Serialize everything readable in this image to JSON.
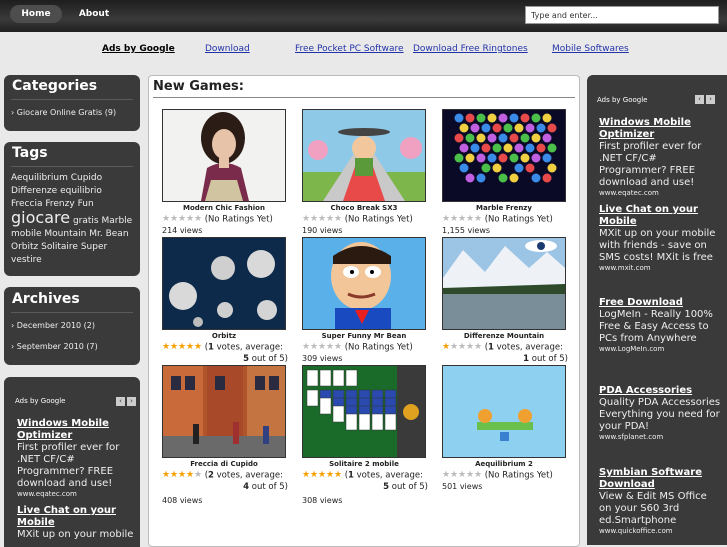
{
  "nav": {
    "home": "Home",
    "about": "About"
  },
  "search": {
    "placeholder": "Type and enter..."
  },
  "linkbar": {
    "ads_by_google": "Ads by Google",
    "links": [
      "Download",
      "Free Pocket PC Software",
      "Download Free Ringtones",
      "Mobile Softwares"
    ]
  },
  "categories": {
    "title": "Categories",
    "items": [
      "Giocare Online Gratis (9)"
    ]
  },
  "tags": {
    "title": "Tags",
    "words": [
      "Aequilibrium",
      "Cupido",
      "Differenze",
      "equilibrio",
      "Freccia",
      "Frenzy",
      "Fun",
      "giocare",
      "gratis",
      "Marble",
      "mobile",
      "Mountain",
      "Mr.",
      "Bean",
      "Orbitz",
      "Solitaire",
      "Super",
      "vestire"
    ]
  },
  "archives": {
    "title": "Archives",
    "items": [
      "December 2010 (2)",
      "September 2010 (7)"
    ]
  },
  "left_ads": {
    "header": "Ads by Google",
    "ads": [
      {
        "title": "Windows Mobile Optimizer",
        "text": "First profiler ever for .NET CF/C# Programmer? FREE download and use!",
        "url": "www.eqatec.com"
      },
      {
        "title": "Live Chat on your Mobile",
        "text": "MXit up on your mobile",
        "url": ""
      }
    ]
  },
  "main": {
    "title": "New Games:",
    "games": [
      {
        "title": "Modern Chic Fashion",
        "rating_text": "(No Ratings Yet)",
        "stars": 0,
        "views": "214 views",
        "votes": null
      },
      {
        "title": "Choco Break SX3",
        "rating_text": "(No Ratings Yet)",
        "stars": 0,
        "views": "190 views",
        "votes": null
      },
      {
        "title": "Marble Frenzy",
        "rating_text": "(No Ratings Yet)",
        "stars": 0,
        "views": "1,155 views",
        "votes": null
      },
      {
        "title": "Orbitz",
        "rating_text": "votes, average:",
        "votes": "1",
        "avg": "5",
        "outof": "out of 5)",
        "stars": 5,
        "views": ""
      },
      {
        "title": "Super Funny Mr Bean",
        "rating_text": "(No Ratings Yet)",
        "stars": 0,
        "views": "309 views",
        "votes": null
      },
      {
        "title": "Differenze Mountain",
        "rating_text": "votes, average:",
        "votes": "1",
        "avg": "1",
        "outof": "out of 5)",
        "stars": 1,
        "views": ""
      },
      {
        "title": "Freccia di Cupido",
        "rating_text": "votes, average:",
        "votes": "2",
        "avg": "4",
        "outof": "out of 5)",
        "stars": 4,
        "views": "408 views"
      },
      {
        "title": "Solitaire 2 mobile",
        "rating_text": "votes, average:",
        "votes": "1",
        "avg": "5",
        "outof": "out of 5)",
        "stars": 5,
        "views": "308 views"
      },
      {
        "title": "Aequilibrium 2",
        "rating_text": "(No Ratings Yet)",
        "stars": 0,
        "views": "501 views",
        "votes": null
      }
    ]
  },
  "right_ads": {
    "header": "Ads by Google",
    "ads": [
      {
        "title": "Windows Mobile Optimizer",
        "text": "First profiler ever for .NET CF/C# Programmer? FREE download and use!",
        "url": "www.eqatec.com"
      },
      {
        "title": "Live Chat on your Mobile",
        "text": "MXit up on your mobile with friends - save on SMS costs! MXit is free",
        "url": "www.mxit.com"
      },
      {
        "title": "Free Download",
        "text": "LogMeIn - Really 100% Free & Easy Access to PCs from Anywhere",
        "url": "www.LogMeIn.com"
      },
      {
        "title": "PDA Accessories",
        "text": "Quality PDA Accessories Everything you need for your PDA!",
        "url": "www.sfplanet.com"
      },
      {
        "title": "Symbian Software Download",
        "text": "View & Edit MS Office on your S60 3rd ed.Smartphone",
        "url": "www.quickoffice.com"
      }
    ]
  }
}
